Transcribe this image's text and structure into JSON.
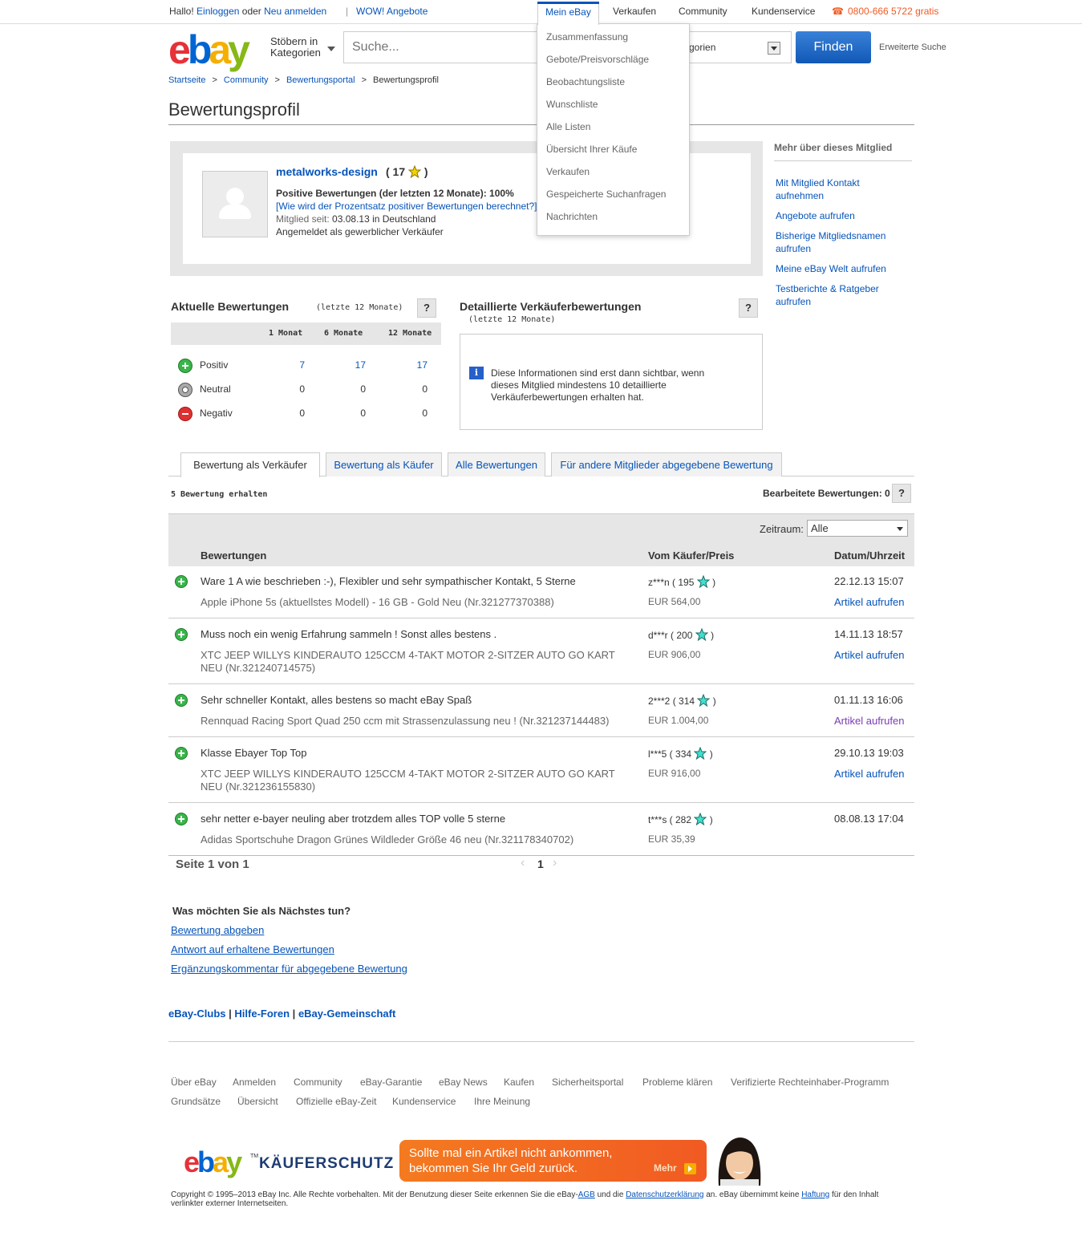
{
  "topbar": {
    "hello": "Hallo!",
    "login": "Einloggen",
    "or": "oder",
    "register": "Neu anmelden",
    "wow": "WOW! Angebote",
    "mebay": "Mein eBay",
    "sell": "Verkaufen",
    "community": "Community",
    "service": "Kundenservice",
    "phone": "0800-666 5722 gratis",
    "phone_icon": "phone-icon"
  },
  "header": {
    "logo": [
      "e",
      "b",
      "a",
      "y"
    ],
    "browse_line1": "Stöbern in",
    "browse_line2": "Kategorien",
    "search_placeholder": "Suche...",
    "category_partial": "tegorien",
    "find": "Finden",
    "advanced": "Erweiterte Suche"
  },
  "mebay_menu": [
    "Zusammenfassung",
    "Gebote/Preisvorschläge",
    "Beobachtungsliste",
    "Wunschliste",
    "Alle Listen",
    "Übersicht Ihrer Käufe",
    "Verkaufen",
    "Gespeicherte Suchanfragen",
    "Nachrichten"
  ],
  "breadcrumb": [
    "Startseite",
    "Community",
    "Bewertungsportal",
    "Bewertungsprofil"
  ],
  "page_title": "Bewertungsprofil",
  "profile": {
    "username": "metalworks-design",
    "score_open": "( 17",
    "score_close": ")",
    "positive": "Positive Bewertungen (der letzten 12 Monate): 100%",
    "pct_link": "[Wie wird der Prozentsatz positiver Bewertungen berechnet?]",
    "since_label": "Mitglied seit:",
    "since_value": "03.08.13 in Deutschland",
    "business": "Angemeldet als gewerblicher Verkäufer"
  },
  "sidebar": {
    "title": "Mehr über dieses Mitglied",
    "links": [
      "Mit Mitglied Kontakt aufnehmen",
      "Angebote aufrufen",
      "Bisherige Mitgliedsnamen aufrufen",
      "Meine eBay Welt aufrufen",
      "Testberichte & Ratgeber aufrufen"
    ]
  },
  "ratings": {
    "title": "Aktuelle Bewertungen",
    "subtitle": "(letzte 12 Monate)",
    "help": "?",
    "columns": [
      "1 Monat",
      "6 Monate",
      "12 Monate"
    ],
    "rows": [
      {
        "label": "Positiv",
        "values": [
          "7",
          "17",
          "17"
        ]
      },
      {
        "label": "Neutral",
        "values": [
          "0",
          "0",
          "0"
        ]
      },
      {
        "label": "Negativ",
        "values": [
          "0",
          "0",
          "0"
        ]
      }
    ]
  },
  "detailed": {
    "title": "Detaillierte Verkäuferbewertungen",
    "subtitle": "(letzte 12 Monate)",
    "help": "?",
    "info_icon": "i",
    "text": "Diese Informationen sind erst dann sichtbar, wenn dieses Mitglied mindestens 10 detaillierte Verkäuferbewertungen erhalten hat."
  },
  "tabs": [
    "Bewertung als Verkäufer",
    "Bewertung als Käufer",
    "Alle Bewertungen",
    "Für andere Mitglieder abgegebene Bewertung"
  ],
  "received": "5 Bewertung erhalten",
  "edited": "Bearbeitete Bewertungen: 0",
  "edited_help": "?",
  "filter": {
    "label": "Zeitraum:",
    "value": "Alle"
  },
  "table_headers": [
    "Bewertungen",
    "Vom Käufer/Preis",
    "Datum/Uhrzeit"
  ],
  "feedback": [
    {
      "comment": "Ware 1 A wie beschrieben :-), Flexibler und sehr sympathischer Kontakt, 5 Sterne",
      "item": "Apple iPhone 5s (aktuellstes Modell) - 16 GB - Gold Neu (Nr.321277370388)",
      "buyer": "z***n ( 195",
      "price": "EUR 564,00",
      "date": "22.12.13 15:07",
      "view": "Artikel aufrufen"
    },
    {
      "comment": "Muss noch ein wenig Erfahrung sammeln ! Sonst alles bestens .",
      "item": "XTC JEEP WILLYS KINDERAUTO 125CCM 4-TAKT MOTOR 2-SITZER AUTO GO KART NEU (Nr.321240714575)",
      "buyer": "d***r ( 200",
      "price": "EUR 906,00",
      "date": "14.11.13 18:57",
      "view": "Artikel aufrufen"
    },
    {
      "comment": "Sehr schneller Kontakt, alles bestens so macht eBay Spaß",
      "item": "Rennquad Racing Sport Quad 250 ccm mit Strassenzulassung neu ! (Nr.321237144483)",
      "buyer": "2***2 ( 314",
      "price": "EUR 1.004,00",
      "date": "01.11.13 16:06",
      "view": "Artikel aufrufen"
    },
    {
      "comment": "Klasse Ebayer Top Top",
      "item": "XTC JEEP WILLYS KINDERAUTO 125CCM 4-TAKT MOTOR 2-SITZER AUTO GO KART NEU (Nr.321236155830)",
      "buyer": "l***5 ( 334",
      "price": "EUR 916,00",
      "date": "29.10.13 19:03",
      "view": "Artikel aufrufen"
    },
    {
      "comment": "sehr netter e-bayer neuling aber trotzdem alles TOP volle 5 sterne",
      "item": "Adidas Sportschuhe Dragon Grünes Wildleder Größe 46 neu (Nr.321178340702)",
      "buyer": "t***s ( 282",
      "price": "EUR 35,39",
      "date": "08.08.13 17:04",
      "view": ""
    }
  ],
  "buyer_close": ")",
  "pager": {
    "text": "Seite 1 von 1",
    "prev": "‹",
    "current": "1",
    "next": "›"
  },
  "next_steps": {
    "title": "Was möchten Sie als Nächstes tun?",
    "links": [
      "Bewertung abgeben",
      "Antwort auf erhaltene Bewertungen",
      "Ergänzungskommentar für abgegebene Bewertung"
    ]
  },
  "clubs": [
    "eBay-Clubs",
    "Hilfe-Foren",
    "eBay-Gemeinschaft"
  ],
  "clubs_sep": "|",
  "footer_row1": [
    "Über eBay",
    "Anmelden",
    "Community",
    "eBay-Garantie",
    "eBay News",
    "Kaufen",
    "Sicherheitsportal",
    "Probleme klären",
    "Verifizierte Rechteinhaber-Programm"
  ],
  "footer_row2": [
    "Grundsätze",
    "Übersicht",
    "Offizielle eBay-Zeit",
    "Kundenservice",
    "Ihre Meinung"
  ],
  "kaeuferschutz": {
    "logo": [
      "e",
      "b",
      "a",
      "y"
    ],
    "tm": "TM",
    "word": "KÄUFERSCHUTZ",
    "line1": "Sollte mal ein Artikel nicht ankommen,",
    "line2": "bekommen Sie Ihr Geld zurück.",
    "more": "Mehr"
  },
  "copyright": {
    "part1": "Copyright © 1995–2013 eBay Inc. Alle Rechte vorbehalten. Mit der Benutzung dieser Seite erkennen Sie die eBay-",
    "agb": "AGB",
    "part2": " und die ",
    "privacy": "Datenschutzerklärung",
    "part3": " an. eBay übernimmt keine ",
    "liability": "Haftung",
    "part4": " für den Inhalt verlinkter externer Internetseiten."
  },
  "colors": {
    "link": "#0654ba",
    "visited": "#7a3cb4",
    "phone": "#f15a22",
    "positive": "#39b54a",
    "negative": "#e03030",
    "banner": "#f47a20"
  }
}
